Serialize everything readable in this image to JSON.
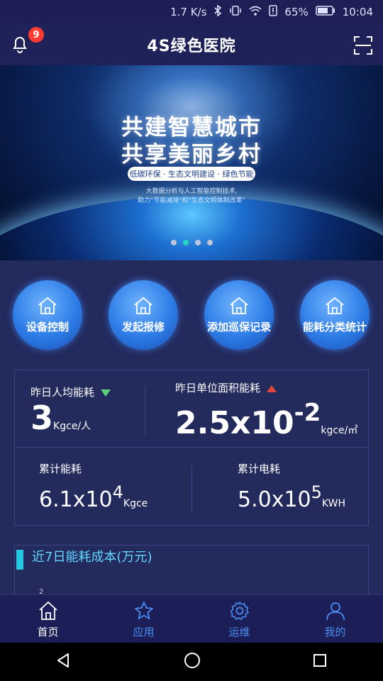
{
  "status_bar": {
    "speed": "1.7 K/s",
    "battery": "65%",
    "time": "10:04"
  },
  "header": {
    "title": "4S绿色医院",
    "notification_count": "9"
  },
  "banner": {
    "line1": "共建智慧城市",
    "line2": "共享美丽乡村",
    "pill": "低碳环保 · 生态文明建设 · 绿色节能",
    "sub1": "大数据分析与人工智能控制技术,",
    "sub2": "助力\"节能减排\"和\"生态文明体制改革\"",
    "active_dot_index": 1
  },
  "quick_actions": [
    {
      "label": "设备控制"
    },
    {
      "label": "发起报修"
    },
    {
      "label": "添加巡保记录"
    },
    {
      "label": "能耗分类统计"
    }
  ],
  "stats": {
    "per_capita_label": "昨日人均能耗",
    "per_capita_value": "3",
    "per_capita_unit": "Kgce/人",
    "per_area_label": "昨日单位面积能耗",
    "per_area_base": "2.5x10",
    "per_area_exp": "-2",
    "per_area_unit": "kgce/㎡",
    "total_energy_label": "累计能耗",
    "total_energy_base": "6.1x10",
    "total_energy_exp": "4",
    "total_energy_unit": "Kgce",
    "total_power_label": "累计电耗",
    "total_power_base": "5.0x10",
    "total_power_exp": "5",
    "total_power_unit": "KWH",
    "down_color": "#5fcf7a",
    "up_color": "#e0463c"
  },
  "chart_section": {
    "title": "近7日能耗成本(万元)",
    "first_tick": "2"
  },
  "tabbar": [
    {
      "label": "首页",
      "icon": "home-icon"
    },
    {
      "label": "应用",
      "icon": "star-icon"
    },
    {
      "label": "运维",
      "icon": "gear-icon"
    },
    {
      "label": "我的",
      "icon": "user-icon"
    }
  ],
  "colors": {
    "background": "#232a5c",
    "tab_inactive": "#4a8cf0",
    "accent": "#22c7e0"
  }
}
